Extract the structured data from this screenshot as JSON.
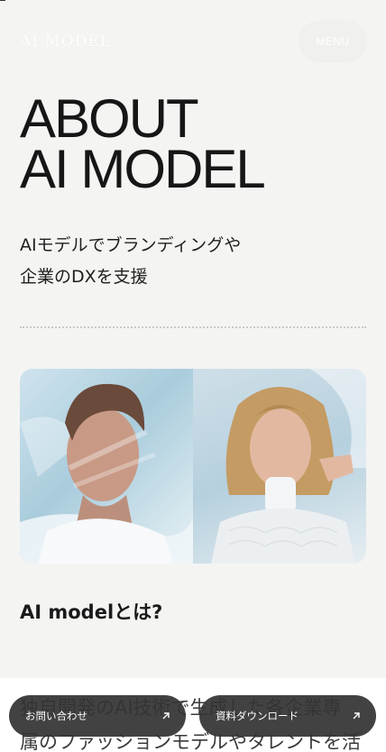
{
  "header": {
    "logo_text": "AI MODEL",
    "menu_label": "MENU"
  },
  "hero": {
    "title_line1": "ABOUT",
    "title_line2": "AI MODEL",
    "subtitle_line1": "AIモデルでブランディングや",
    "subtitle_line2": "企業のDXを支援"
  },
  "section": {
    "heading": "AI modelとは?",
    "body_line1": "独自開発のAI技術で生成した各企業専",
    "body_line2": "属のファッションモデルやタレントを活"
  },
  "cta": {
    "contact_label": "お問い合わせ",
    "download_label": "資料ダウンロード"
  },
  "icons": {
    "contact": "arrow-up-right-icon",
    "download": "arrow-up-right-icon"
  }
}
